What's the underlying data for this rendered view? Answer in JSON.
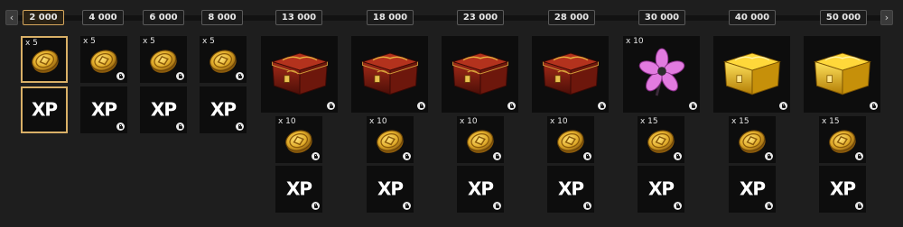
{
  "nav": {
    "prev": "‹",
    "next": "›"
  },
  "tiers": [
    "2 000",
    "4 000",
    "6 000",
    "8 000",
    "13 000",
    "18 000",
    "23 000",
    "28 000",
    "30 000",
    "40 000",
    "50 000"
  ],
  "rewards": {
    "coin": {
      "icon": "gold-coin-icon",
      "quantities": [
        "x 5",
        "x 5",
        "x 5",
        "x 5",
        "x 10",
        "x 10",
        "x 10",
        "x 10",
        "x 15",
        "x 15",
        "x 15"
      ]
    },
    "big": [
      {
        "icon": "red-chest-icon"
      },
      {
        "icon": "red-chest-icon"
      },
      {
        "icon": "red-chest-icon"
      },
      {
        "icon": "red-chest-icon"
      },
      {
        "icon": "pink-flower-icon",
        "qty": "x 10"
      },
      {
        "icon": "gold-chest-icon"
      },
      {
        "icon": "gold-chest-icon"
      }
    ],
    "xp_label": "XP"
  },
  "colors": {
    "selected": "#d9b067",
    "coin": "#e4b83a",
    "red_chest": "#7b1d12",
    "gold_chest": "#f0c21a",
    "flower": "#e27be0"
  }
}
